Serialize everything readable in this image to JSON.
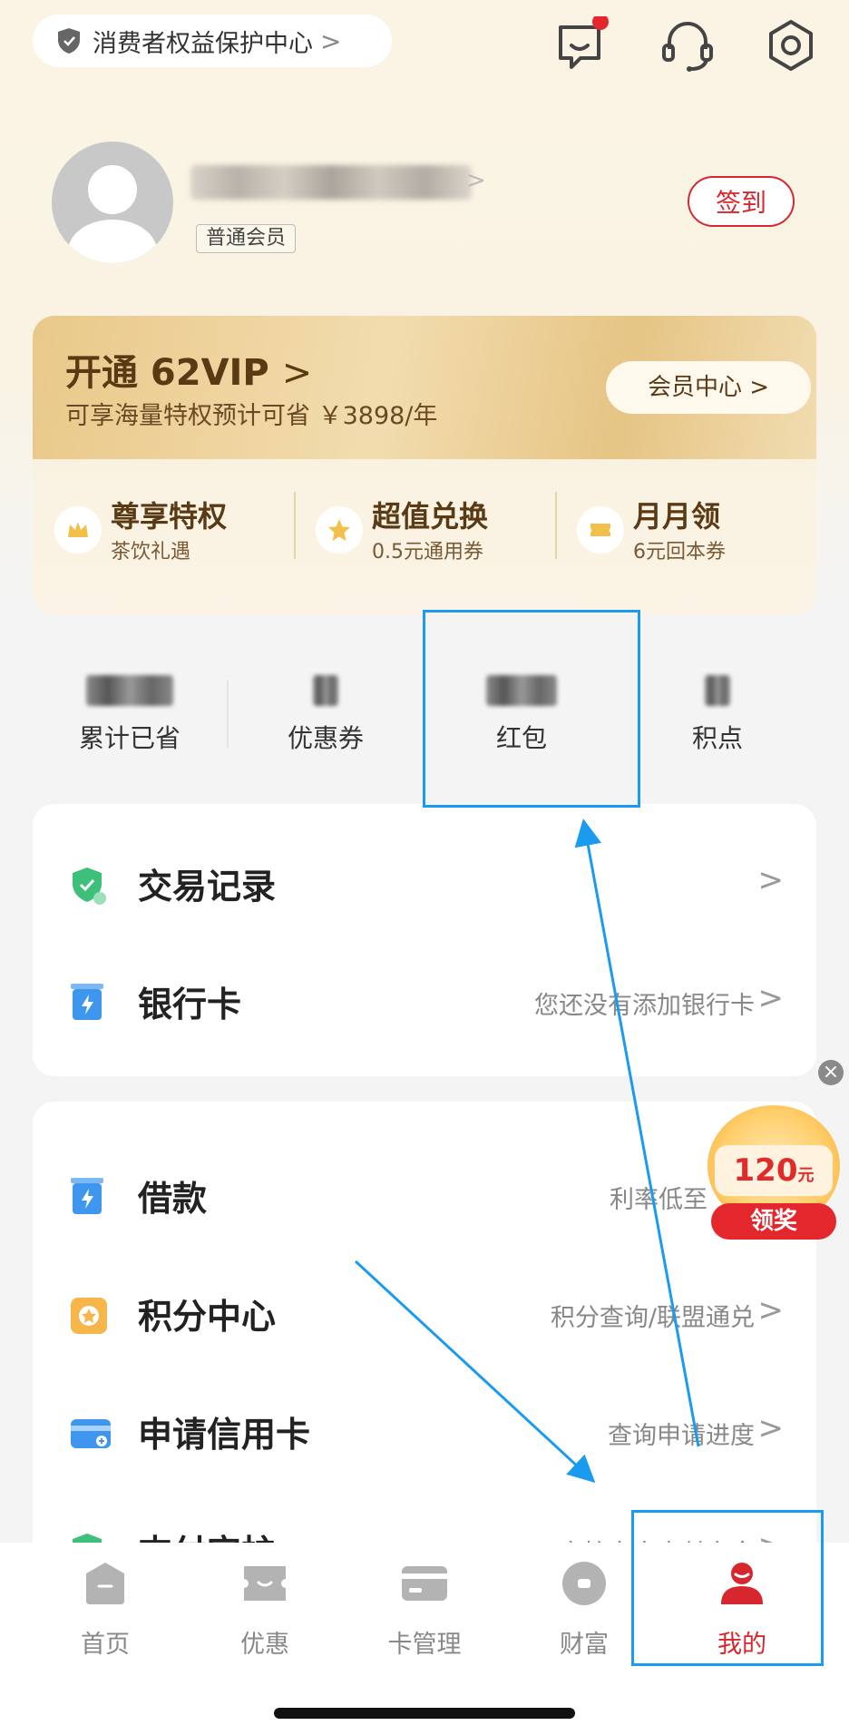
{
  "header": {
    "consumer_center_label": "消费者权益保护中心",
    "chevron": ">"
  },
  "profile": {
    "member_tag": "普通会员",
    "signin_label": "签到"
  },
  "vip": {
    "title": "开通 62VIP",
    "title_chevron": ">",
    "subtitle": "可享海量特权预计可省 ￥3898/年",
    "member_center_label": "会员中心",
    "perks": [
      {
        "title": "尊享特权",
        "subtitle": "茶饮礼遇",
        "icon": "crown-icon"
      },
      {
        "title": "超值兑换",
        "subtitle": "0.5元通用券",
        "icon": "star-icon"
      },
      {
        "title": "月月领",
        "subtitle": "6元回本券",
        "icon": "ticket-icon"
      }
    ]
  },
  "stats": [
    {
      "label": "累计已省"
    },
    {
      "label": "优惠券"
    },
    {
      "label": "红包"
    },
    {
      "label": "积点"
    }
  ],
  "list_card_1": [
    {
      "label": "交易记录",
      "hint": ""
    },
    {
      "label": "银行卡",
      "hint": "您还没有添加银行卡"
    }
  ],
  "list_card_2": [
    {
      "label": "借款",
      "hint": "利率低至"
    },
    {
      "label": "积分中心",
      "hint": "积分查询/联盟通兑"
    },
    {
      "label": "申请信用卡",
      "hint": "查询申请进度"
    },
    {
      "label": "支付守护",
      "hint": "守护家人支付安全"
    }
  ],
  "promo": {
    "amount": "120",
    "unit": "元",
    "claim_label": "领奖",
    "close": "×"
  },
  "tabbar": [
    {
      "label": "首页",
      "active": false
    },
    {
      "label": "优惠",
      "active": false
    },
    {
      "label": "卡管理",
      "active": false
    },
    {
      "label": "财富",
      "active": false
    },
    {
      "label": "我的",
      "active": true
    }
  ],
  "colors": {
    "brand_red": "#d8262e",
    "annotation_blue": "#1a9bf0",
    "vip_gold": "#e9c98a"
  }
}
